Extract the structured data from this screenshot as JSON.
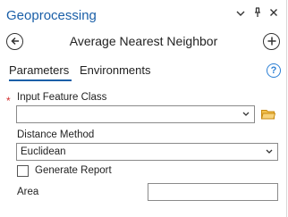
{
  "pane": {
    "title": "Geoprocessing",
    "title_icons": [
      "chevron-down-icon",
      "pin-icon",
      "close-icon"
    ]
  },
  "tool": {
    "name": "Average Nearest Neighbor",
    "back_icon": "back-arrow-icon",
    "add_icon": "plus-icon"
  },
  "tabs": {
    "parameters": "Parameters",
    "environments": "Environments",
    "help_symbol": "?"
  },
  "form": {
    "input_feature_class": {
      "required_marker": "*",
      "label": "Input Feature Class",
      "value": ""
    },
    "distance_method": {
      "label": "Distance Method",
      "value": "Euclidean"
    },
    "generate_report": {
      "label": "Generate Report",
      "checked": false
    },
    "area": {
      "label": "Area",
      "value": ""
    }
  },
  "colors": {
    "accent": "#1a5fa8",
    "required": "#d32f2f",
    "folder": "#e6a817"
  }
}
